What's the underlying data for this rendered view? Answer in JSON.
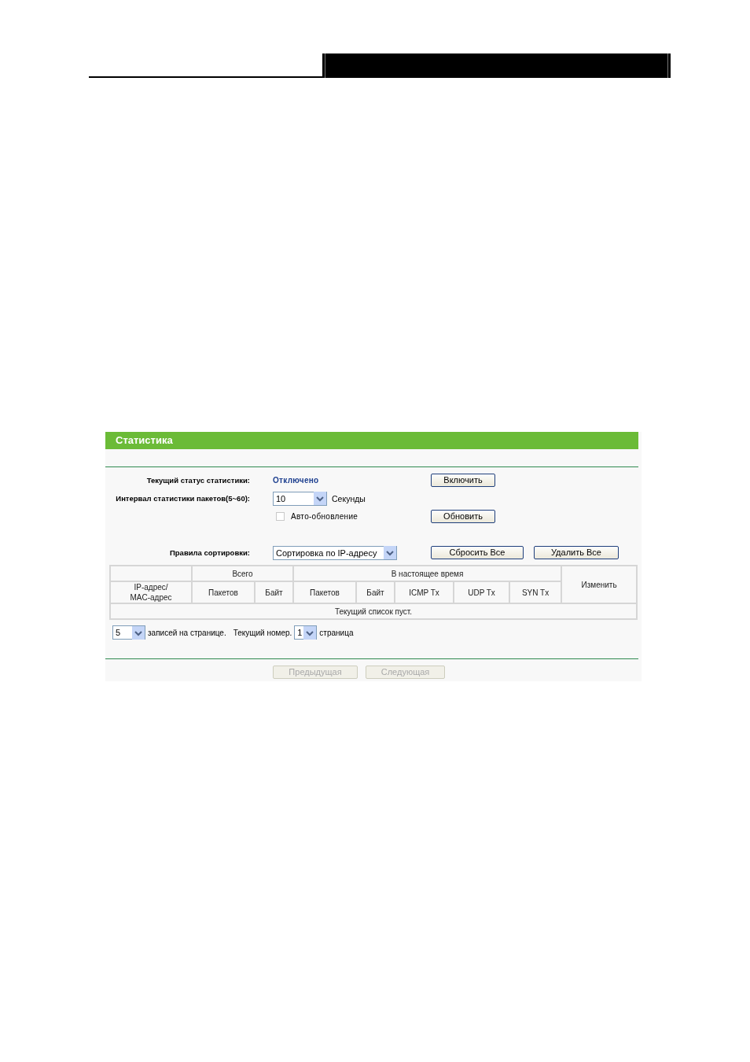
{
  "panel": {
    "title": "Статистика"
  },
  "status": {
    "label": "Текущий статус статистики:",
    "value": "Отключено",
    "button": "Включить"
  },
  "interval": {
    "label": "Интервал статистики пакетов(5~60):",
    "value": "10",
    "unit": "Секунды"
  },
  "auto_refresh": {
    "label": "Авто-обновление",
    "checked": false,
    "button": "Обновить"
  },
  "sorting": {
    "label": "Правила сортировки:",
    "value": "Сортировка по IP-адресу",
    "buttons": [
      {
        "label": "Сбросить Все"
      },
      {
        "label": "Удалить Все"
      }
    ]
  },
  "table": {
    "columns": [
      {
        "kind": "single",
        "label": "IP-адрес/\nMAC-адрес"
      },
      {
        "kind": "group",
        "label": "Всего",
        "columns": [
          "Пакетов",
          "Байт"
        ]
      },
      {
        "kind": "group",
        "label": "В настоящее время",
        "columns": [
          "Пакетов",
          "Байт",
          "ICMP Tx",
          "UDP Tx",
          "SYN Tx"
        ]
      },
      {
        "kind": "action",
        "label": "Изменить"
      }
    ],
    "empty_message": "Текущий список пуст."
  },
  "pagination": {
    "per_page": "5",
    "per_page_label": "записей на странице.",
    "current_label": "Текущий номер.",
    "page": "1",
    "page_label": "страница"
  },
  "nav_buttons": [
    {
      "label": "Предыдущая",
      "disabled": true
    },
    {
      "label": "Следующая",
      "disabled": true
    }
  ]
}
